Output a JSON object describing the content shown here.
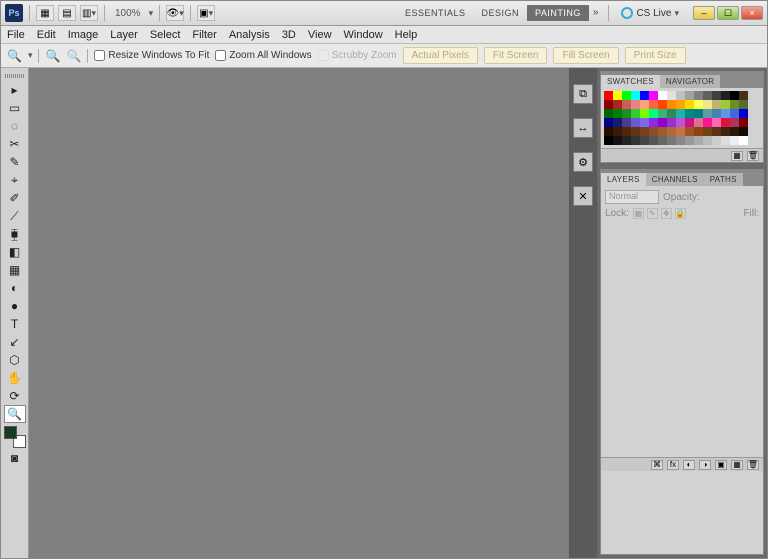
{
  "title": {
    "zoom": "100%"
  },
  "workspace": {
    "tabs": [
      "ESSENTIALS",
      "DESIGN",
      "PAINTING"
    ],
    "active": 2,
    "cslive": "CS Live"
  },
  "winbtns": {
    "min": "–",
    "max": "☐",
    "close": "×"
  },
  "menu": [
    "File",
    "Edit",
    "Image",
    "Layer",
    "Select",
    "Filter",
    "Analysis",
    "3D",
    "View",
    "Window",
    "Help"
  ],
  "options": {
    "resize": "Resize Windows To Fit",
    "zoomall": "Zoom All Windows",
    "scrubby": "Scrubby Zoom",
    "btns": [
      "Actual Pixels",
      "Fit Screen",
      "Fill Screen",
      "Print Size"
    ]
  },
  "tools": [
    "▸",
    "▭",
    "◌",
    "✂",
    "✎",
    "⌖",
    "✐",
    "⟋",
    "⧯",
    "◧",
    "▦",
    "◐",
    "●",
    "T",
    "↙",
    "⬡",
    "✋",
    "⟳",
    "🔍"
  ],
  "dock": [
    "⧉",
    "↔",
    "⚙",
    "✕"
  ],
  "swatch_panel": {
    "tabs": [
      "SWATCHES",
      "NAVIGATOR"
    ],
    "active": 0
  },
  "swatch_colors": [
    "#ff0000",
    "#ffff00",
    "#00ff00",
    "#00ffff",
    "#0000ff",
    "#ff00ff",
    "#ffffff",
    "#e0e0e0",
    "#c0c0c0",
    "#a0a0a0",
    "#808080",
    "#606060",
    "#404040",
    "#202020",
    "#000000",
    "#4a2e19",
    "#8b0000",
    "#b22222",
    "#cd5c5c",
    "#f08080",
    "#ffa07a",
    "#ff6347",
    "#ff4500",
    "#ff8c00",
    "#ffa500",
    "#ffd700",
    "#ffff54",
    "#f0e68c",
    "#bdb76b",
    "#9acd32",
    "#6b8e23",
    "#556b2f",
    "#006400",
    "#008000",
    "#228b22",
    "#32cd32",
    "#7cfc00",
    "#00ff7f",
    "#3cb371",
    "#2e8b57",
    "#20b2aa",
    "#008b8b",
    "#008080",
    "#5f9ea0",
    "#4682b4",
    "#6495ed",
    "#4169e1",
    "#0000cd",
    "#00008b",
    "#191970",
    "#483d8b",
    "#6a5acd",
    "#7b68ee",
    "#8a2be2",
    "#9400d3",
    "#9932cc",
    "#ba55d3",
    "#c71585",
    "#db7093",
    "#ff1493",
    "#ff69b4",
    "#dc143c",
    "#b03060",
    "#800000",
    "#260d02",
    "#3b1a08",
    "#4f2710",
    "#633418",
    "#774120",
    "#8b4e28",
    "#9f5b30",
    "#b36838",
    "#c77540",
    "#a0522d",
    "#8b4513",
    "#704214",
    "#5a3410",
    "#3e240a",
    "#281705",
    "#140b02",
    "#000000",
    "#111111",
    "#222222",
    "#333333",
    "#444444",
    "#555555",
    "#666666",
    "#777777",
    "#888888",
    "#999999",
    "#aaaaaa",
    "#bbbbbb",
    "#cccccc",
    "#dddddd",
    "#eeeeee",
    "#ffffff"
  ],
  "layers_panel": {
    "tabs": [
      "LAYERS",
      "CHANNELS",
      "PATHS"
    ],
    "active": 0,
    "blend_label": "Normal",
    "opacity_label": "Opacity:",
    "lock_label": "Lock:",
    "fill_label": "Fill:"
  }
}
